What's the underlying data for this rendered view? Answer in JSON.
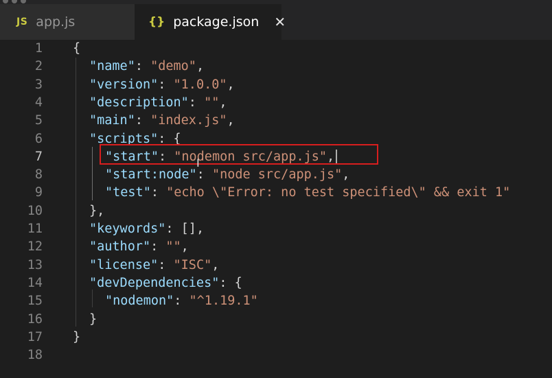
{
  "tabs": [
    {
      "icon": "JS",
      "label": "app.js",
      "active": false
    },
    {
      "icon": "{}",
      "label": "package.json",
      "active": true,
      "close": "✕"
    }
  ],
  "lines": [
    {
      "n": "1",
      "parts": [
        [
          "p",
          "{"
        ]
      ]
    },
    {
      "n": "2",
      "parts": [
        [
          "k",
          "\"name\""
        ],
        [
          "p",
          ": "
        ],
        [
          "s",
          "\"demo\""
        ],
        [
          "p",
          ","
        ]
      ]
    },
    {
      "n": "3",
      "parts": [
        [
          "k",
          "\"version\""
        ],
        [
          "p",
          ": "
        ],
        [
          "s",
          "\"1.0.0\""
        ],
        [
          "p",
          ","
        ]
      ]
    },
    {
      "n": "4",
      "parts": [
        [
          "k",
          "\"description\""
        ],
        [
          "p",
          ": "
        ],
        [
          "s",
          "\"\""
        ],
        [
          "p",
          ","
        ]
      ]
    },
    {
      "n": "5",
      "parts": [
        [
          "k",
          "\"main\""
        ],
        [
          "p",
          ": "
        ],
        [
          "s",
          "\"index.js\""
        ],
        [
          "p",
          ","
        ]
      ]
    },
    {
      "n": "6",
      "parts": [
        [
          "k",
          "\"scripts\""
        ],
        [
          "p",
          ": {"
        ]
      ]
    },
    {
      "n": "7",
      "parts": [
        [
          "k",
          "\"start\""
        ],
        [
          "p",
          ": "
        ],
        [
          "s",
          "\"nodemon src/app.js\""
        ],
        [
          "p",
          ","
        ]
      ],
      "active": true
    },
    {
      "n": "8",
      "parts": [
        [
          "k",
          "\"start:node\""
        ],
        [
          "p",
          ": "
        ],
        [
          "s",
          "\"node src/app.js\""
        ],
        [
          "p",
          ","
        ]
      ]
    },
    {
      "n": "9",
      "parts": [
        [
          "k",
          "\"test\""
        ],
        [
          "p",
          ": "
        ],
        [
          "s",
          "\"echo \\\"Error: no test specified\\\" && exit 1\""
        ]
      ]
    },
    {
      "n": "10",
      "parts": [
        [
          "p",
          "},"
        ]
      ]
    },
    {
      "n": "11",
      "parts": [
        [
          "k",
          "\"keywords\""
        ],
        [
          "p",
          ": [],"
        ]
      ]
    },
    {
      "n": "12",
      "parts": [
        [
          "k",
          "\"author\""
        ],
        [
          "p",
          ": "
        ],
        [
          "s",
          "\"\""
        ],
        [
          "p",
          ","
        ]
      ]
    },
    {
      "n": "13",
      "parts": [
        [
          "k",
          "\"license\""
        ],
        [
          "p",
          ": "
        ],
        [
          "s",
          "\"ISC\""
        ],
        [
          "p",
          ","
        ]
      ]
    },
    {
      "n": "14",
      "parts": [
        [
          "k",
          "\"devDependencies\""
        ],
        [
          "p",
          ": {"
        ]
      ]
    },
    {
      "n": "15",
      "parts": [
        [
          "k",
          "\"nodemon\""
        ],
        [
          "p",
          ": "
        ],
        [
          "s",
          "\"^1.19.1\""
        ]
      ]
    },
    {
      "n": "16",
      "parts": [
        [
          "p",
          "}"
        ]
      ]
    },
    {
      "n": "17",
      "parts": [
        [
          "p",
          "}"
        ]
      ]
    },
    {
      "n": "18",
      "parts": []
    }
  ],
  "colors": {
    "key": "#9cdcfe",
    "string": "#ce9178",
    "highlight_box": "#d91e1e"
  }
}
